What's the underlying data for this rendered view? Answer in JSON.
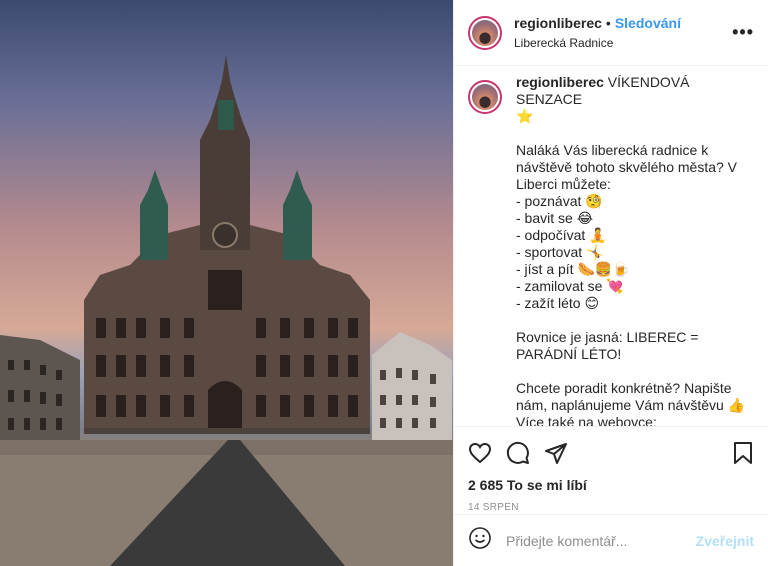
{
  "header": {
    "username": "regionliberec",
    "separator": "•",
    "follow_label": "Sledování",
    "location": "Liberecká Radnice",
    "more_icon": "more-horizontal-icon"
  },
  "caption": {
    "username": "regionliberec",
    "text": " VÍKENDOVÁ SENZACE\n⭐\n\nNaláká Vás liberecká radnice k návštěvě tohoto skvělého města? V Liberci můžete:\n- poznávat 🧐\n- bavit se 😂\n- odpočívat 🧘\n- sportovat 🤸\n- jíst a pít 🌭🍔🍺\n- zamilovat se 💘\n- zažít léto 😊\n\nRovnice je jasná: LIBEREC = PARÁDNÍ LÉTO!\n\nChcete poradit konkrétně? Napište nám, naplánujeme Vám návštěvu 👍\nVíce také na webovce:\n"
  },
  "actions": {
    "like_icon": "heart-icon",
    "comment_icon": "comment-icon",
    "share_icon": "paper-plane-icon",
    "save_icon": "bookmark-icon",
    "likes_text": "2 685 To se mi líbí",
    "date": "14 SRPEN"
  },
  "comment": {
    "emoji_icon": "smiley-icon",
    "placeholder": "Přidejte komentář...",
    "publish_label": "Zveřejnit"
  },
  "colors": {
    "accent": "#3897f0",
    "publish_disabled": "#b2dffc",
    "muted": "#8e8e8e",
    "story_ring": "#c9356f"
  }
}
